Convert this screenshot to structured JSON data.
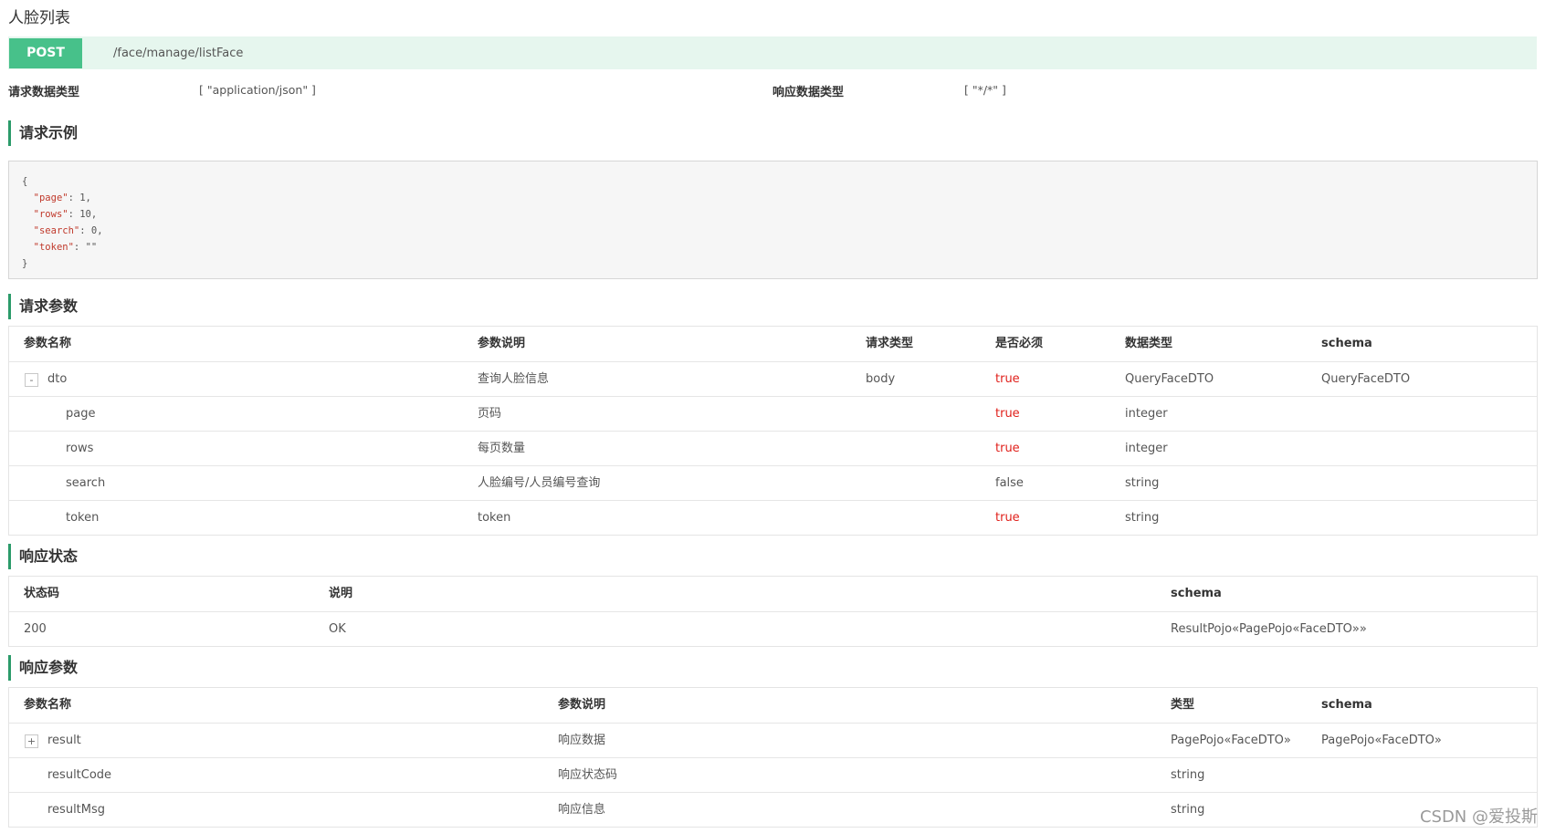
{
  "page_title": "人脸列表",
  "endpoint": {
    "method": "POST",
    "path": "/face/manage/listFace"
  },
  "mime": {
    "request_label": "请求数据类型",
    "request_value": "[ \"application/json\" ]",
    "response_label": "响应数据类型",
    "response_value": "[ \"*/*\" ]"
  },
  "request_example": {
    "title": "请求示例",
    "lines": [
      {
        "key": "",
        "val": "{"
      },
      {
        "key": "\"page\"",
        "val": ": 1,"
      },
      {
        "key": "\"rows\"",
        "val": ": 10,"
      },
      {
        "key": "\"search\"",
        "val": ": 0,"
      },
      {
        "key": "\"token\"",
        "val": ": \"\""
      },
      {
        "key": "",
        "val": "}"
      }
    ]
  },
  "request_params": {
    "title": "请求参数",
    "headers": [
      "参数名称",
      "参数说明",
      "请求类型",
      "是否必须",
      "数据类型",
      "schema"
    ],
    "rows": [
      {
        "toggle": "-",
        "name": "dto",
        "desc": "查询人脸信息",
        "in": "body",
        "required": "true",
        "type": "QueryFaceDTO",
        "schema": "QueryFaceDTO"
      },
      {
        "toggle": "",
        "name": "page",
        "desc": "页码",
        "in": "",
        "required": "true",
        "type": "integer",
        "schema": ""
      },
      {
        "toggle": "",
        "name": "rows",
        "desc": "每页数量",
        "in": "",
        "required": "true",
        "type": "integer",
        "schema": ""
      },
      {
        "toggle": "",
        "name": "search",
        "desc": "人脸编号/人员编号查询",
        "in": "",
        "required": "false",
        "type": "string",
        "schema": ""
      },
      {
        "toggle": "",
        "name": "token",
        "desc": "token",
        "in": "",
        "required": "true",
        "type": "string",
        "schema": ""
      }
    ]
  },
  "response_status": {
    "title": "响应状态",
    "headers": [
      "状态码",
      "说明",
      "schema"
    ],
    "rows": [
      {
        "code": "200",
        "desc": "OK",
        "schema": "ResultPojo«PagePojo«FaceDTO»»"
      }
    ]
  },
  "response_params": {
    "title": "响应参数",
    "headers": [
      "参数名称",
      "参数说明",
      "类型",
      "schema"
    ],
    "rows": [
      {
        "toggle": "+",
        "name": "result",
        "desc": "响应数据",
        "type": "PagePojo«FaceDTO»",
        "schema": "PagePojo«FaceDTO»"
      },
      {
        "toggle": "",
        "name": "resultCode",
        "desc": "响应状态码",
        "type": "string",
        "schema": ""
      },
      {
        "toggle": "",
        "name": "resultMsg",
        "desc": "响应信息",
        "type": "string",
        "schema": ""
      }
    ]
  },
  "watermark": "CSDN @爱投斯",
  "colors": {
    "accent": "#2b9b6a",
    "method_badge": "#47c18a",
    "endpoint_bg": "#e6f6ee",
    "required_true": "#e0201b"
  }
}
